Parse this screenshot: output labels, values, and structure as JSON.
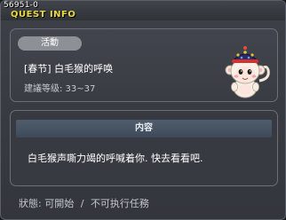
{
  "window": {
    "quest_id": "56951-0",
    "title": "QUEST INFO"
  },
  "quest": {
    "category": "活動",
    "name": "[春节] 白毛猴的呼唤",
    "level_requirement": "建議等级: 33~37",
    "npc_icon": "monkey-npc-portrait"
  },
  "content": {
    "header": "内容",
    "description": "白毛猴声嘶力竭的呼喊着你. 快去看看吧."
  },
  "status": {
    "label": "狀態:",
    "can_start": "可開始",
    "separator": "/",
    "cannot_do": "不可执行任務"
  }
}
